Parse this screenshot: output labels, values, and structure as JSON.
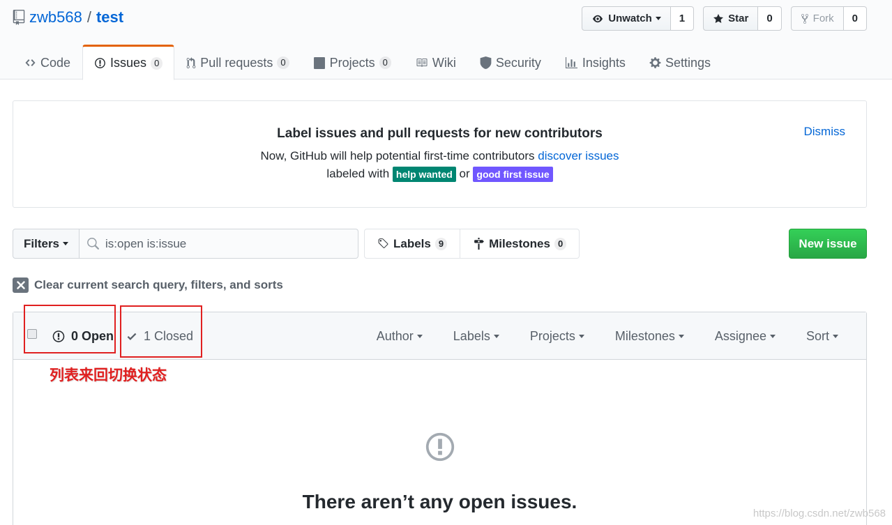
{
  "repo": {
    "owner": "zwb568",
    "separator": "/",
    "name": "test"
  },
  "actions": {
    "watch": {
      "label": "Unwatch",
      "count": "1"
    },
    "star": {
      "label": "Star",
      "count": "0"
    },
    "fork": {
      "label": "Fork",
      "count": "0"
    }
  },
  "nav": {
    "code": {
      "label": "Code"
    },
    "issues": {
      "label": "Issues",
      "count": "0"
    },
    "pulls": {
      "label": "Pull requests",
      "count": "0"
    },
    "projects": {
      "label": "Projects",
      "count": "0"
    },
    "wiki": {
      "label": "Wiki"
    },
    "security": {
      "label": "Security"
    },
    "insights": {
      "label": "Insights"
    },
    "settings": {
      "label": "Settings"
    }
  },
  "banner": {
    "title": "Label issues and pull requests for new contributors",
    "line1_prefix": "Now, GitHub will help potential first-time contributors",
    "line1_link": "discover issues",
    "line2_prefix": "labeled with",
    "label_help": "help wanted",
    "line2_or": "or",
    "label_good": "good first issue",
    "dismiss": "Dismiss",
    "colors": {
      "help_wanted": "#008672",
      "good_first_issue": "#7057ff"
    }
  },
  "toolbar": {
    "filters_label": "Filters",
    "search_value": "is:open is:issue",
    "labels_label": "Labels",
    "labels_count": "9",
    "milestones_label": "Milestones",
    "milestones_count": "0",
    "new_issue_label": "New issue"
  },
  "clear_query": "Clear current search query, filters, and sorts",
  "issues": {
    "open_label": "0 Open",
    "closed_label": "1 Closed",
    "filters": [
      "Author",
      "Labels",
      "Projects",
      "Milestones",
      "Assignee",
      "Sort"
    ],
    "empty_title": "There aren’t any open issues."
  },
  "annotation": {
    "text": "列表来回切换状态",
    "color": "#e02020"
  },
  "watermark": "https://blog.csdn.net/zwb568"
}
